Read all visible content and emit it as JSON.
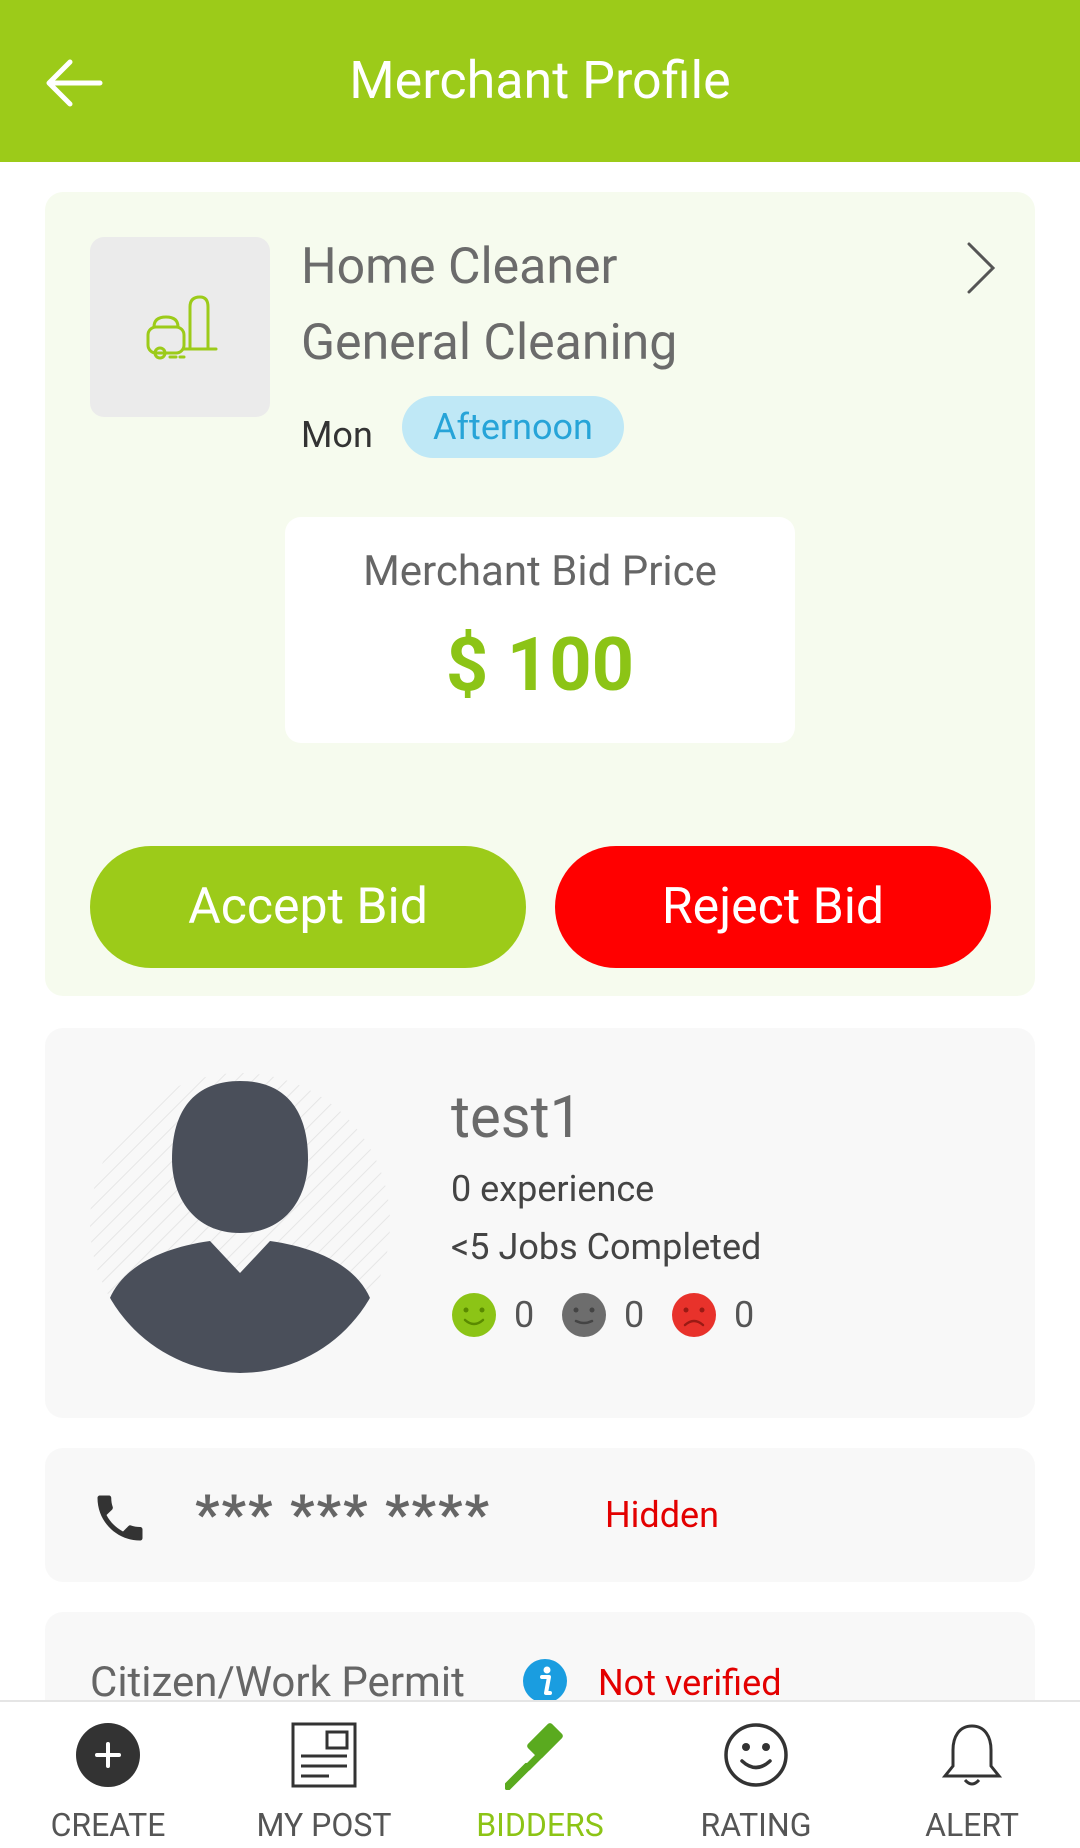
{
  "appbar": {
    "title": "Merchant Profile",
    "color": "#9ccb19"
  },
  "job": {
    "title": "Home Cleaner",
    "subtitle": "General Cleaning",
    "day": "Mon",
    "slot": "Afternoon",
    "price_label": "Merchant Bid Price",
    "price_value": "$ 100",
    "accept_label": "Accept Bid",
    "reject_label": "Reject Bid",
    "icon": "vacuum-cleaner-icon"
  },
  "merchant": {
    "name": "test1",
    "experience": "0 experience",
    "jobs": "<5 Jobs Completed",
    "ratings": {
      "positive": "0",
      "neutral": "0",
      "negative": "0"
    }
  },
  "contact": {
    "phone": "*** *** ****",
    "status": "Hidden"
  },
  "permit": {
    "label": "Citizen/Work Permit",
    "status": "Not verified"
  },
  "nav": {
    "items": [
      {
        "label": "CREATE",
        "icon": "plus-circle-icon"
      },
      {
        "label": "MY POST",
        "icon": "newspaper-icon"
      },
      {
        "label": "BIDDERS",
        "icon": "gavel-icon"
      },
      {
        "label": "RATING",
        "icon": "smiley-icon"
      },
      {
        "label": "ALERT",
        "icon": "bell-icon"
      }
    ],
    "active_index": 2
  },
  "colors": {
    "accent": "#9ccb19",
    "reject": "#ff0000",
    "pill_bg": "#bfe8f6",
    "pill_text": "#27a4d8",
    "warning_text": "#e30000"
  }
}
